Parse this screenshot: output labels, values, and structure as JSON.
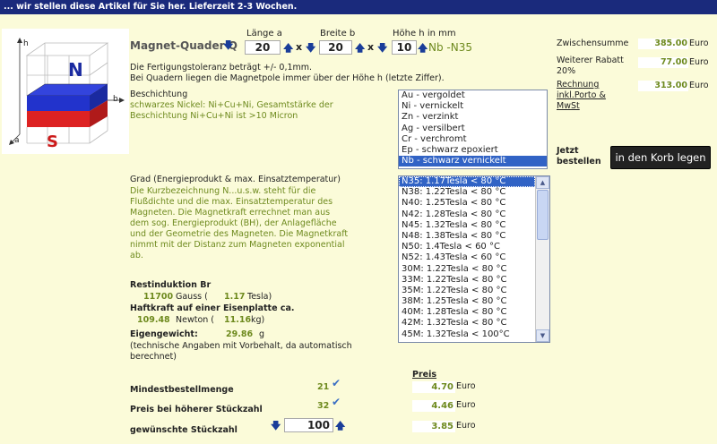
{
  "header": {
    "notice": "... wir stellen diese Artikel für Sie her. Lieferzeit 2-3 Wochen."
  },
  "magnet_image": {
    "label_n": "N",
    "label_s": "S",
    "axis_h": "h",
    "axis_a": "a",
    "axis_b": "b",
    "colors": {
      "north": "#2233cc",
      "south": "#dd2222"
    }
  },
  "product": {
    "title": "Magnet-Quader Q",
    "length_label": "Länge a",
    "length_value": "20",
    "width_label": "Breite b",
    "width_value": "20",
    "height_label": "Höhe h in mm",
    "height_value": "10",
    "times": "x",
    "grade_suffix": "Nb -N35",
    "tolerance": "Die Fertigungstoleranz beträgt +/- 0,1mm.",
    "pole_note": "Bei Quadern liegen die Magnetpole immer über der Höhe h (letzte Ziffer)."
  },
  "coating": {
    "label": "Beschichtung",
    "description": "schwarzes Nickel: Ni+Cu+Ni, Gesamtstärke der Beschichtung Ni+Cu+Ni ist >10 Micron",
    "options": [
      "Au - vergoldet",
      "Ni - vernickelt",
      "Zn - verzinkt",
      "Ag - versilbert",
      "Cr - verchromt",
      "Ep - schwarz epoxiert",
      "Nb - schwarz vernickelt"
    ],
    "selected_index": 6
  },
  "grade": {
    "label": "Grad (Energieprodukt & max. Einsatztemperatur)",
    "description": "Die Kurzbezeichnung N...u.s.w. steht für die Flußdichte und die max. Einsatztemperatur des Magneten. Die Magnetkraft errechnet man aus dem sog. Energieprodukt (BH), der Anlagefläche und der Geometrie des Magneten. Die Magnetkraft nimmt mit der Distanz zum Magneten exponential ab.",
    "options": [
      "N35: 1.17Tesla < 80 °C",
      "N38: 1.22Tesla < 80 °C",
      "N40: 1.25Tesla < 80 °C",
      "N42: 1.28Tesla < 80 °C",
      "N45: 1.32Tesla < 80 °C",
      "N48: 1.38Tesla < 80 °C",
      "N50: 1.4Tesla < 60 °C",
      "N52: 1.43Tesla < 60 °C",
      "30M: 1.22Tesla < 80 °C",
      "33M: 1.22Tesla < 80 °C",
      "35M: 1.22Tesla < 80 °C",
      "38M: 1.25Tesla < 80 °C",
      "40M: 1.28Tesla < 80 °C",
      "42M: 1.32Tesla < 80 °C",
      "45M: 1.32Tesla < 100°C"
    ],
    "selected_index": 0
  },
  "specs": {
    "remanence_label": "Restinduktion Br",
    "remanence_gauss": "11700",
    "gauss_unit": "Gauss (",
    "remanence_tesla": "1.17",
    "tesla_unit": "Tesla)",
    "force_label": "Haftkraft auf einer Eisenplatte ca.",
    "force_newton": "109.48",
    "newton_unit": "Newton (",
    "force_kg": "11.16",
    "kg_unit": "kg)",
    "weight_label": "Eigengewicht:",
    "weight_value": "29.86",
    "weight_unit": "g",
    "disclaimer": "(technische Angaben mit Vorbehalt, da automatisch berechnet)"
  },
  "summary": {
    "subtotal_label": "Zwischensumme",
    "subtotal_value": "385.00",
    "discount_label": "Weiterer Rabatt 20%",
    "discount_value": "77.00",
    "invoice_label": "Rechnung inkl.Porto & MwSt",
    "invoice_value": "313.00",
    "currency": "Euro"
  },
  "order": {
    "label": "Jetzt bestellen",
    "button": "in den Korb legen"
  },
  "pricing": {
    "header": "Preis",
    "min_order_label": "Mindestbestellmenge",
    "min_order_qty": "21",
    "min_order_price": "4.70",
    "bulk_label": "Preis bei höherer Stückzahl",
    "bulk_qty": "32",
    "bulk_price": "4.46",
    "desired_label": "gewünschte Stückzahl",
    "desired_qty": "100",
    "desired_price": "3.85",
    "currency": "Euro"
  }
}
